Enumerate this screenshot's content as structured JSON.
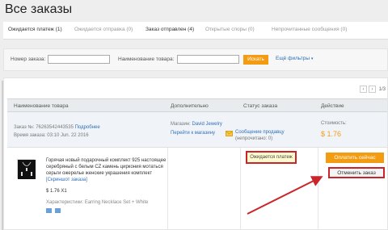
{
  "page": {
    "title": "Все заказы"
  },
  "tabs": [
    {
      "label": "Ожидается платеж (1)"
    },
    {
      "label": "Ожидается отправка (0)"
    },
    {
      "label": "Заказ отправлен (4)"
    },
    {
      "label": "Открытые споры (0)"
    },
    {
      "label": "Непрочитанные сообщения (0)"
    }
  ],
  "search": {
    "order_number_label": "Номер заказа:",
    "product_name_label": "Наименование товара:",
    "search_button": "Искать",
    "more_filters": "Ещё фильтры"
  },
  "pager": {
    "page": "1/3"
  },
  "table": {
    "headers": [
      "Наименование товара",
      "Дополнительно",
      "Статус заказа",
      "Действие"
    ]
  },
  "order": {
    "order_no_label": "Заказ №:",
    "order_no": "76263542443535",
    "details_link": "Подробнее",
    "time_label": "Время заказа:",
    "time": "03:10 Jun. 22 2016",
    "store_label": "Магазин:",
    "store_name": "David Jewelry",
    "go_to_store": "Перейти к магазину",
    "message_seller": "Сообщение продавцу",
    "unread": "(непрочитано: 0)",
    "cost_label": "Стоимость:",
    "cost": "$ 1.76",
    "product_desc": "Горячая новый подарочный комплект 925 настоящее серебряный с белым CZ камень циркония мотаться серьги ожерелье женские украшения комплект",
    "screenshot_link": "[Скриншот заказа]",
    "qty_price": "$ 1.76 X1",
    "characteristics": "Характеристики: Earring Necklace Set + White",
    "status": "Ожидается платеж",
    "pay_button": "Оплатить сейчас",
    "cancel_button": "Отменить заказ"
  },
  "colors": {
    "accent": "#f39c12",
    "highlight": "#c9252b",
    "link": "#2f6fb8"
  }
}
